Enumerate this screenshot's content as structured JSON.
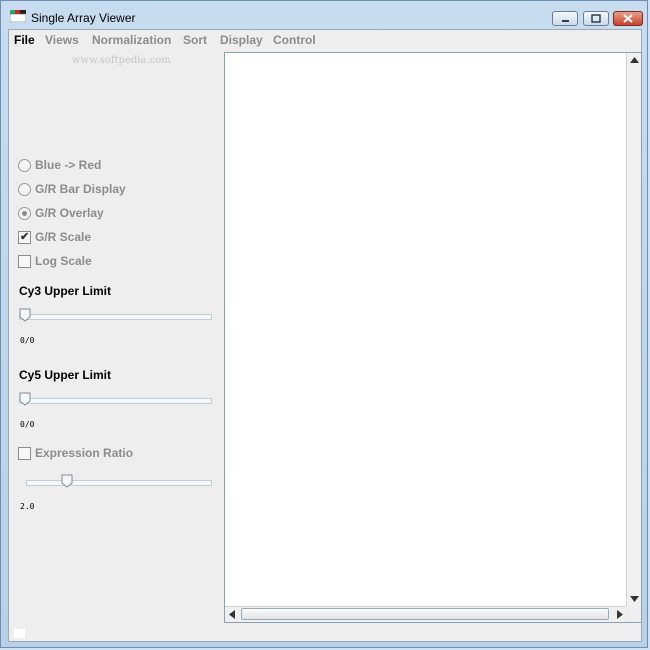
{
  "window": {
    "title": "Single Array Viewer"
  },
  "menu": [
    {
      "label": "File",
      "enabled": true
    },
    {
      "label": "Views",
      "enabled": false
    },
    {
      "label": "Normalization",
      "enabled": false
    },
    {
      "label": "Sort",
      "enabled": false
    },
    {
      "label": "Display",
      "enabled": false
    },
    {
      "label": "Control",
      "enabled": false
    }
  ],
  "watermark": "www.softpedia.com",
  "options": {
    "blue_red": "Blue -> Red",
    "gr_bar": "G/R Bar Display",
    "gr_overlay": "G/R Overlay",
    "gr_scale": "G/R Scale",
    "log_scale": "Log Scale",
    "expression_ratio": "Expression Ratio"
  },
  "selected_display": "G/R Overlay",
  "checked": {
    "gr_scale": true,
    "log_scale": false,
    "expression_ratio": false
  },
  "cy3": {
    "label": "Cy3 Upper Limit",
    "value": "0/0",
    "fraction": 0.0
  },
  "cy5": {
    "label": "Cy5 Upper Limit",
    "value": "0/0",
    "fraction": 0.0
  },
  "ratio": {
    "value": "2.0",
    "fraction": 0.2
  },
  "colors": {
    "enabled_text": "#000000",
    "disabled_text": "#8c8c8c",
    "close_button": "#c7412a"
  },
  "icons": [
    "app-icon",
    "minimize-icon",
    "maximize-icon",
    "close-icon",
    "scroll-up-arrow-icon",
    "scroll-down-arrow-icon",
    "scroll-left-arrow-icon",
    "scroll-right-arrow-icon"
  ]
}
